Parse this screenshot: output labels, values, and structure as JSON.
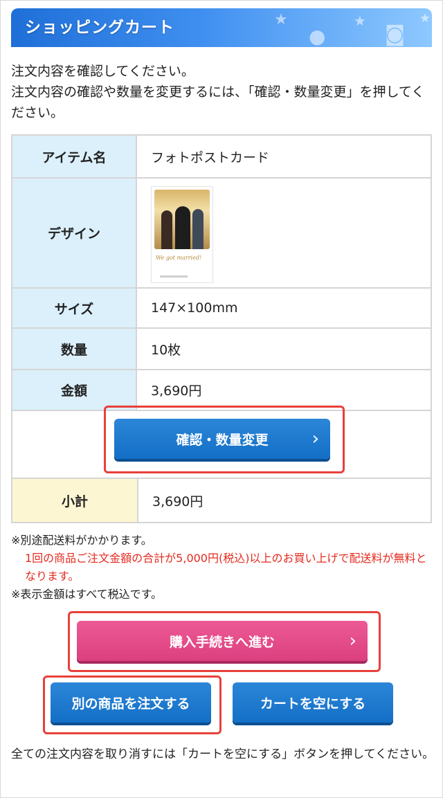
{
  "header": {
    "title": "ショッピングカート"
  },
  "intro": {
    "line1": "注文内容を確認してください。",
    "line2": "注文内容の確認や数量を変更するには、「確認・数量変更」を押してください。"
  },
  "item": {
    "name_label": "アイテム名",
    "name_value": "フォトポストカード",
    "design_label": "デザイン",
    "design_caption": "We got married!",
    "size_label": "サイズ",
    "size_value": "147×100mm",
    "qty_label": "数量",
    "qty_value": "10枚",
    "price_label": "金額",
    "price_value": "3,690円"
  },
  "buttons": {
    "confirm_change": "確認・数量変更",
    "checkout": "購入手続きへ進む",
    "order_other": "別の商品を注文する",
    "empty_cart": "カートを空にする"
  },
  "subtotal": {
    "label": "小計",
    "value": "3,690円"
  },
  "notes": {
    "shipping": "※別途配送料がかかります。",
    "free_shipping": "1回の商品ご注文金額の合計が5,000円(税込)以上のお買い上げで配送料が無料となります。",
    "tax": "※表示金額はすべて税込です。"
  },
  "footer": {
    "text": "全ての注文内容を取り消すには「カートを空にする」ボタンを押してください。"
  },
  "colors": {
    "header_blue": "#1f6fd8",
    "table_header_blue": "#dbf0fb",
    "subtotal_header_yellow": "#fdf6d2",
    "button_blue": "#136fc6",
    "button_pink": "#dc3f7f",
    "highlight_red": "#e8403a",
    "notice_red": "#e52a1f"
  },
  "icons": {
    "chevron": "chevron-right-icon"
  }
}
